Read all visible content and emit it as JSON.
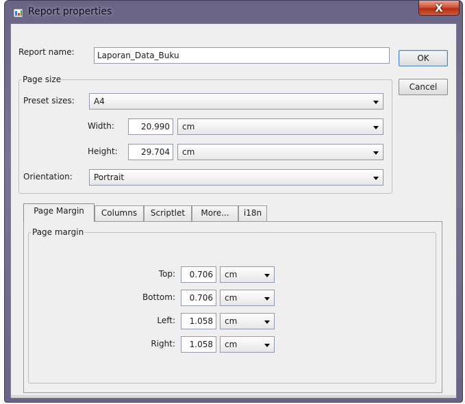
{
  "window": {
    "title": "Report properties",
    "close_symbol": "X",
    "icon": "report-app-icon"
  },
  "buttons": {
    "ok": "OK",
    "cancel": "Cancel"
  },
  "report_name": {
    "label": "Report name:",
    "value": "Laporan_Data_Buku"
  },
  "page_size": {
    "legend": "Page size",
    "preset_label": "Preset sizes:",
    "preset_value": "A4",
    "width_label": "Width:",
    "width_value": "20.990",
    "width_unit": "cm",
    "height_label": "Height:",
    "height_value": "29.704",
    "height_unit": "cm",
    "orientation_label": "Orientation:",
    "orientation_value": "Portrait"
  },
  "tabs": [
    {
      "label": "Page Margin",
      "active": true
    },
    {
      "label": "Columns",
      "active": false
    },
    {
      "label": "Scriptlet",
      "active": false
    },
    {
      "label": "More...",
      "active": false
    },
    {
      "label": "i18n",
      "active": false
    }
  ],
  "page_margin": {
    "legend": "Page margin",
    "top": {
      "label": "Top:",
      "value": "0.706",
      "unit": "cm"
    },
    "bottom": {
      "label": "Bottom:",
      "value": "0.706",
      "unit": "cm"
    },
    "left": {
      "label": "Left:",
      "value": "1.058",
      "unit": "cm"
    },
    "right": {
      "label": "Right:",
      "value": "1.058",
      "unit": "cm"
    }
  },
  "colors": {
    "frame": "#6b6486",
    "close_button": "#c9472b",
    "panel": "#efefef",
    "default_button_border": "#4f86c8"
  }
}
